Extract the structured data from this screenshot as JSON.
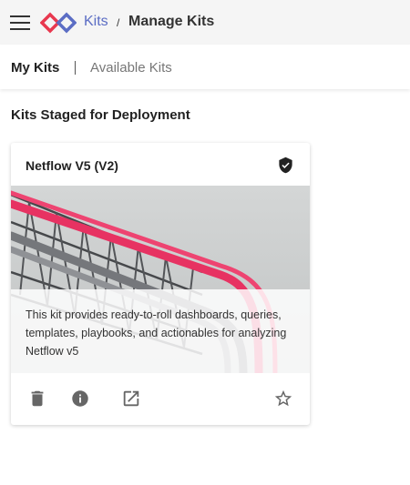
{
  "header": {
    "menu_icon": "hamburger-menu-icon",
    "logo_icon": "kits-logo-icon",
    "breadcrumb": {
      "root": "Kits",
      "separator": "/",
      "current": "Manage Kits"
    },
    "accent_color": "#5b6dc4"
  },
  "tabs": [
    {
      "label": "My Kits",
      "active": true
    },
    {
      "label": "Available Kits",
      "active": false
    }
  ],
  "section_title": "Kits Staged for Deployment",
  "kits": [
    {
      "title": "Netflow V5 (V2)",
      "verified_icon": "verified-shield-icon",
      "description": "This kit provides ready-to-roll dashboards, queries, templates, playbooks, and actionables for analyzing Netflow v5",
      "image": "industrial-pipes-image",
      "actions": {
        "delete_icon": "trash-icon",
        "info_icon": "info-icon",
        "open_icon": "open-in-new-icon",
        "favorite_icon": "star-outline-icon"
      }
    }
  ]
}
